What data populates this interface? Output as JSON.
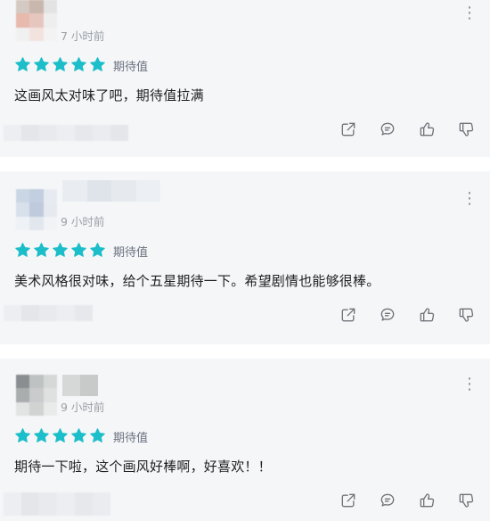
{
  "colors": {
    "star": "#1bbec9",
    "card_bg": "#f5f6f8",
    "time": "#9aa0a6",
    "icon": "#6f7378"
  },
  "reviews": [
    {
      "time": "7 小时前",
      "rating_label": "期待值",
      "stars": 5,
      "text": "这画风太对味了吧，期待值拉满",
      "avatar_colors": [
        "#d5c9c3",
        "#c9b7ad",
        "#e3e3e3",
        "#e8b9ad",
        "#e6c7bf",
        "#eeeeee",
        "#f0f0f0",
        "#f3e3de",
        "#f3f3f3"
      ]
    },
    {
      "time": "9 小时前",
      "rating_label": "期待值",
      "stars": 5,
      "text": "美术风格很对味，给个五星期待一下。希望剧情也能够很棒。",
      "avatar_colors": [
        "#cbd6e4",
        "#c2cfe0",
        "#e7ebf1",
        "#d8e0ec",
        "#bfcadc",
        "#e6eaf0",
        "#eef1f5",
        "#e2e7ee",
        "#f1f3f6"
      ]
    },
    {
      "time": "9 小时前",
      "rating_label": "期待值",
      "stars": 5,
      "text": "期待一下啦，这个画风好棒啊，好喜欢！！",
      "avatar_colors": [
        "#8a8e90",
        "#bfc2c3",
        "#d6d8d8",
        "#a9adae",
        "#c9cbcc",
        "#dfe1e1",
        "#e2e4e4",
        "#d1d3d3",
        "#e9ebeb"
      ]
    }
  ],
  "actions": {
    "share": "share-icon",
    "comment": "comment-icon",
    "like": "thumbs-up-icon",
    "dislike": "thumbs-down-icon"
  }
}
